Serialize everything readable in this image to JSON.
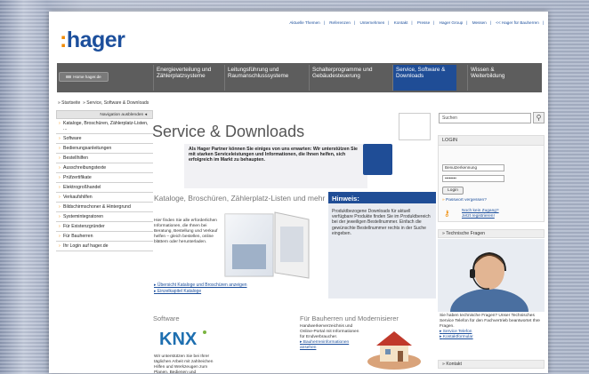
{
  "brand": {
    "logo_colon": ":",
    "logo_name": "hager"
  },
  "topnav": [
    "Aktuelle Themen",
    "|",
    "Referenzen",
    "|",
    "Unternehmen",
    "|",
    "Kontakt",
    "|",
    "Presse",
    "|",
    "Hager Group",
    "|",
    "Messen",
    "|",
    "<< Hager für Bauherren",
    "|"
  ],
  "home_button": "Home hager.de",
  "mainnav": [
    {
      "label": "Energieverteilung und Zählerplatzsysteme"
    },
    {
      "label": "Leitungsführung und Raumanschlusssysteme"
    },
    {
      "label": "Schalterprogramme und Gebäudesteuerung"
    },
    {
      "label": "Service, Software & Downloads",
      "active": true
    },
    {
      "label": "Wissen & Weiterbildung"
    }
  ],
  "breadcrumb": {
    "home": "» Startseite",
    "current": "» Service, Software & Downloads"
  },
  "sidebar": {
    "header": "Navigation ausblenden",
    "items": [
      "Kataloge, Broschüren, Zählerplatz-Listen, ...",
      "Software",
      "Bedienungsanleitungen",
      "Bestellhilfen",
      "Ausschreibungstexte",
      "Prüfzertifikate",
      "Elektrogroßhandel",
      "Verkaufshilfen",
      "Bildschirmschoner & Hintergrund",
      "Systemintegratoren",
      "Für Existenzgründer",
      "Für Bauherren",
      "Ihr Login auf hager.de"
    ]
  },
  "main": {
    "title": "Service & Downloads",
    "partner_text": "Als Hager Partner können Sie einiges von uns erwarten: Wir unterstützen Sie mit starken Serviceleistungen und Informationen, die Ihnen helfen, sich erfolgreich im Markt zu behaupten.",
    "kataloge": {
      "title": "Kataloge, Broschüren, Zählerplatz-Listen und mehr",
      "text": "Hier finden Sie alle erforderlichen Informationen, die Ihnen bei Beratung, Bestellung und Verkauf helfen – gleich bestellen, online blättern oder herunterladen.",
      "link1": "Übersicht Kataloge und Broschüren anzeigen",
      "link2": "Einzelkapitel Kataloge"
    },
    "hinweis": {
      "title": "Hinweis:",
      "text": "Produktbezogene Downloads für aktuell verfügbare Produkte finden Sie im Produktbereich bei der jeweiligen Bestellnummer. Einfach die gewünschte Bestellnummer rechts in der Suche eingeben."
    },
    "software": {
      "title": "Software",
      "logo": "KNX",
      "text": "Wir unterstützen Sie bei Ihrer täglichen Arbeit mit zahlreichen Hilfen und Werkzeugen zum Planen, Bedienen und"
    },
    "bauherren": {
      "title": "Für Bauherren und Modernisierer",
      "text": "Handwerkerverzeichnis und Online-Portal mit Informationen für Endverbraucher.",
      "link": "Bauherreninformationen ansehen"
    }
  },
  "right": {
    "search_placeholder": "Suchen",
    "login": {
      "title": "LOGIN",
      "user_placeholder": "Benutzerkennung",
      "password_value": "••••••••",
      "button": "Login",
      "forgot": "Passwort vergessen?",
      "register_line1": "Noch kein Zugang?",
      "register_line2": "Jetzt registrieren!"
    },
    "tech": {
      "header": "» Technische Fragen",
      "text": "Sie haben technische Fragen? Unser Technisches Service Telefon für den Fachvertrieb beantwortet Ihre Fragen.",
      "link1": "Service Telefon",
      "link2": "Kontaktformular"
    },
    "kontakt": "» Kontakt"
  }
}
